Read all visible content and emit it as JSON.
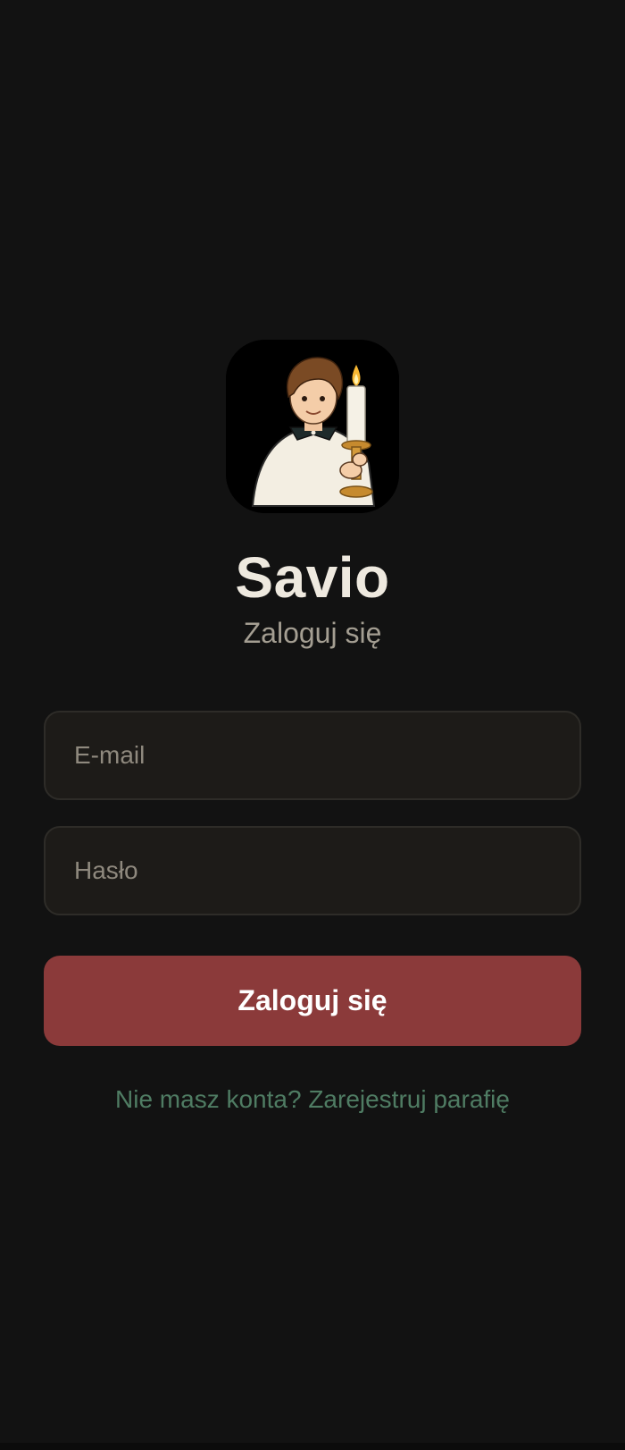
{
  "app": {
    "logo_icon": "altar-server-with-candle-icon",
    "title": "Savio",
    "subtitle": "Zaloguj się"
  },
  "form": {
    "email": {
      "value": "",
      "placeholder": "E-mail"
    },
    "password": {
      "value": "",
      "placeholder": "Hasło"
    },
    "submit_label": "Zaloguj się"
  },
  "register": {
    "link_text": "Nie masz konta? Zarejestruj parafię"
  },
  "colors": {
    "background": "#121212",
    "primary_button": "#8b3a3a",
    "link": "#4f7c63",
    "title": "#eee9df",
    "subtitle": "#a49e92"
  }
}
